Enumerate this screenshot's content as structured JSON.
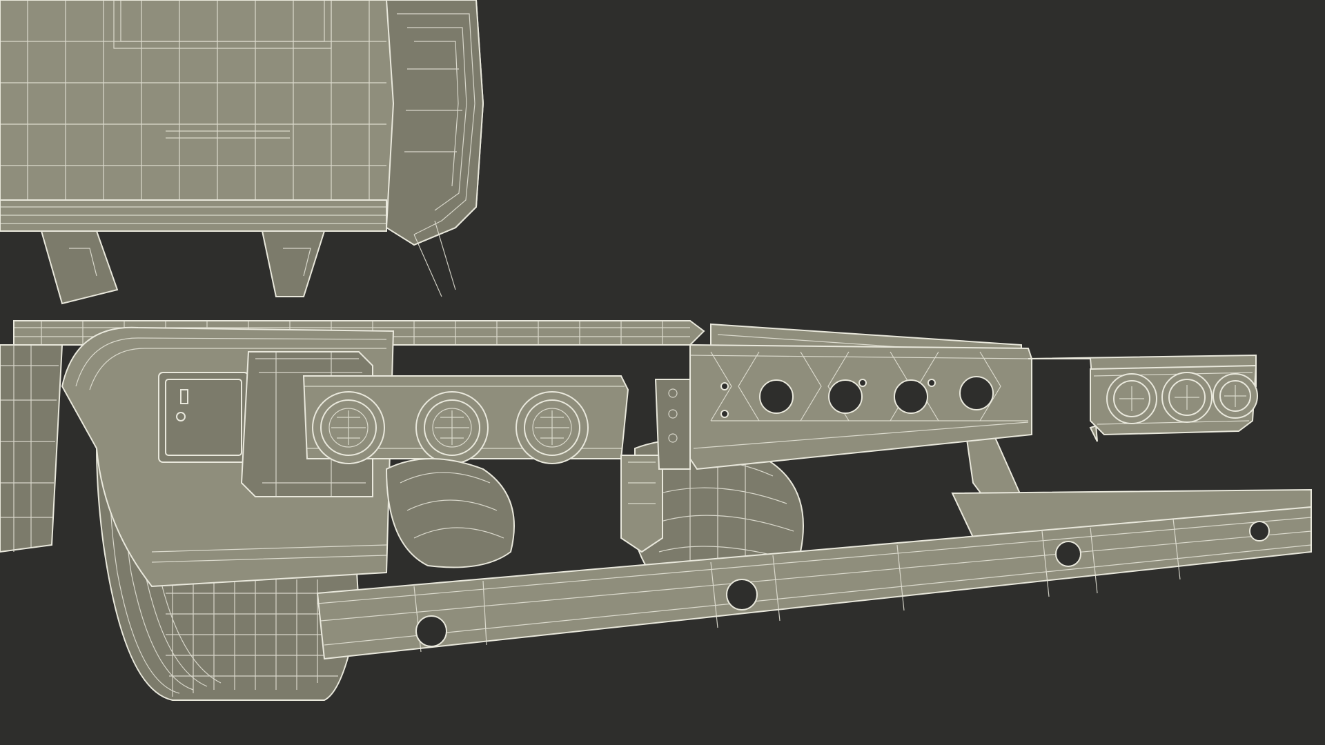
{
  "scene": {
    "subject": "truck-chassis-wireframe-render",
    "colors": {
      "background": "#2e2e2c",
      "model_fill": "#8f8e7c",
      "wire": "#e9e8dc"
    }
  }
}
